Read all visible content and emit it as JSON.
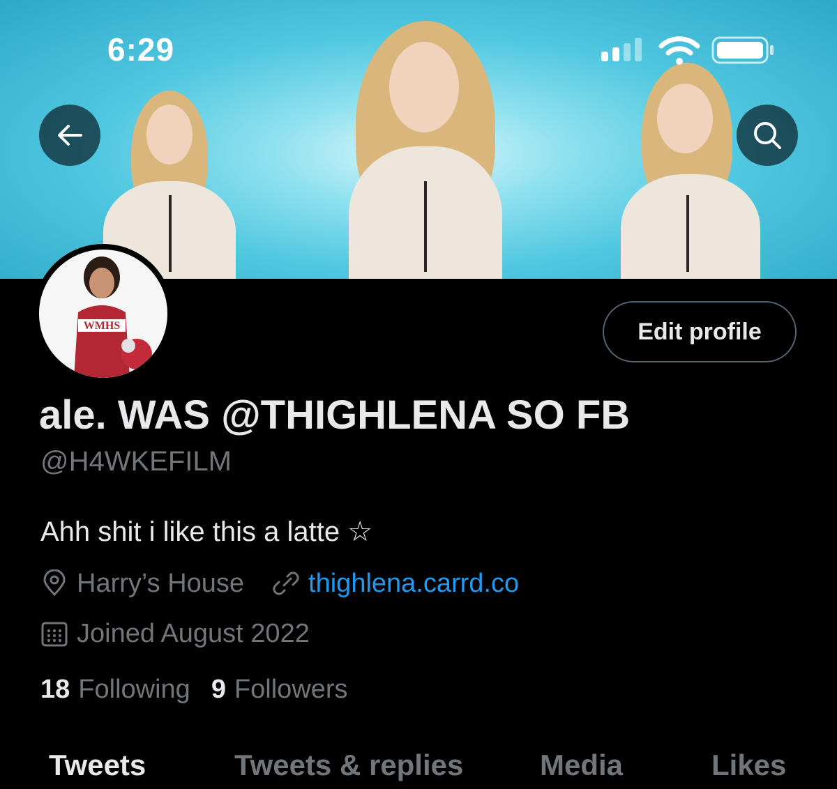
{
  "status_bar": {
    "time": "6:29"
  },
  "icons": {
    "back": "arrow-left-icon",
    "search": "search-icon",
    "location": "location-pin-icon",
    "link": "link-icon",
    "calendar": "calendar-icon"
  },
  "profile": {
    "display_name": "ale. WAS @THIGHLENA SO FB",
    "handle": "@H4WKEFILM",
    "bio": "Ahh shit i like this a latte ☆",
    "location": "Harry’s House",
    "website": "thighlena.carrd.co",
    "joined": "Joined August 2022",
    "following_count": "18",
    "following_label": "Following",
    "followers_count": "9",
    "followers_label": "Followers",
    "avatar_jersey_text": "WMHS"
  },
  "actions": {
    "edit_profile": "Edit profile"
  },
  "tabs": [
    {
      "label": "Tweets",
      "active": true
    },
    {
      "label": "Tweets & replies",
      "active": false
    },
    {
      "label": "Media",
      "active": false
    },
    {
      "label": "Likes",
      "active": false
    }
  ],
  "colors": {
    "background": "#000000",
    "primary_text": "#e7e9ea",
    "secondary_text": "#71767b",
    "link": "#1d9bf0",
    "banner": "#4fc7e0"
  }
}
